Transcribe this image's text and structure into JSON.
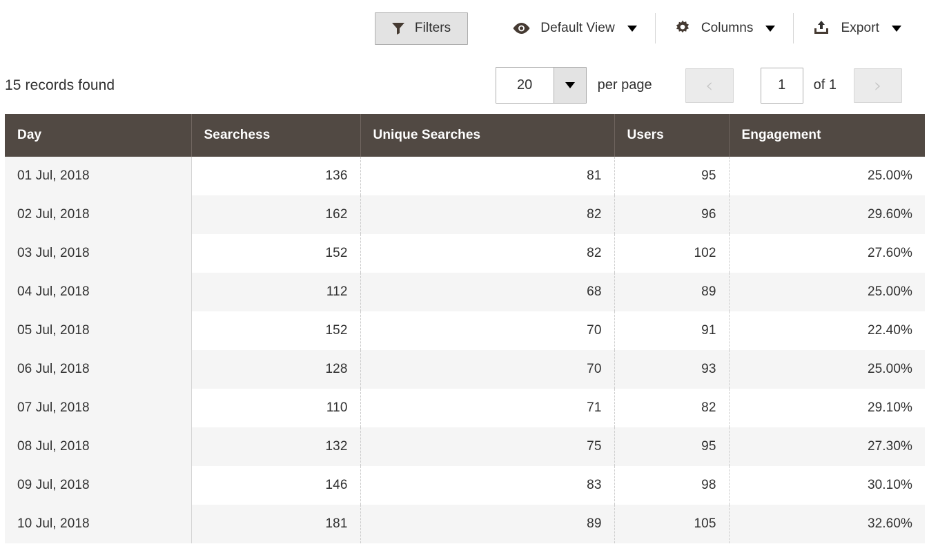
{
  "toolbar": {
    "filters": {
      "label": "Filters",
      "icon": "filter-funnel-icon"
    },
    "view": {
      "label": "Default View",
      "icon": "eye-icon"
    },
    "columns": {
      "label": "Columns",
      "icon": "gear-icon"
    },
    "export": {
      "label": "Export",
      "icon": "upload-export-icon"
    }
  },
  "subbar": {
    "records_found": "15 records found",
    "per_page_value": "20",
    "per_page_label": "per page",
    "page_value": "1",
    "page_total_label": "of 1",
    "prev_icon": "chevron-left-icon",
    "next_icon": "chevron-right-icon"
  },
  "table": {
    "columns": [
      "Day",
      "Searchess",
      "Unique Searches",
      "Users",
      "Engagement"
    ],
    "rows": [
      {
        "day": "01 Jul, 2018",
        "searches": "136",
        "unique": "81",
        "users": "95",
        "engagement": "25.00%"
      },
      {
        "day": "02 Jul, 2018",
        "searches": "162",
        "unique": "82",
        "users": "96",
        "engagement": "29.60%"
      },
      {
        "day": "03 Jul, 2018",
        "searches": "152",
        "unique": "82",
        "users": "102",
        "engagement": "27.60%"
      },
      {
        "day": "04 Jul, 2018",
        "searches": "112",
        "unique": "68",
        "users": "89",
        "engagement": "25.00%"
      },
      {
        "day": "05 Jul, 2018",
        "searches": "152",
        "unique": "70",
        "users": "91",
        "engagement": "22.40%"
      },
      {
        "day": "06 Jul, 2018",
        "searches": "128",
        "unique": "70",
        "users": "93",
        "engagement": "25.00%"
      },
      {
        "day": "07 Jul, 2018",
        "searches": "110",
        "unique": "71",
        "users": "82",
        "engagement": "29.10%"
      },
      {
        "day": "08 Jul, 2018",
        "searches": "132",
        "unique": "75",
        "users": "95",
        "engagement": "27.30%"
      },
      {
        "day": "09 Jul, 2018",
        "searches": "146",
        "unique": "83",
        "users": "98",
        "engagement": "30.10%"
      },
      {
        "day": "10 Jul, 2018",
        "searches": "181",
        "unique": "89",
        "users": "105",
        "engagement": "32.60%"
      }
    ]
  },
  "colors": {
    "header_bg": "#514943",
    "stripe_bg": "#f5f5f5",
    "button_bg": "#e3e3e3",
    "text": "#303030"
  }
}
